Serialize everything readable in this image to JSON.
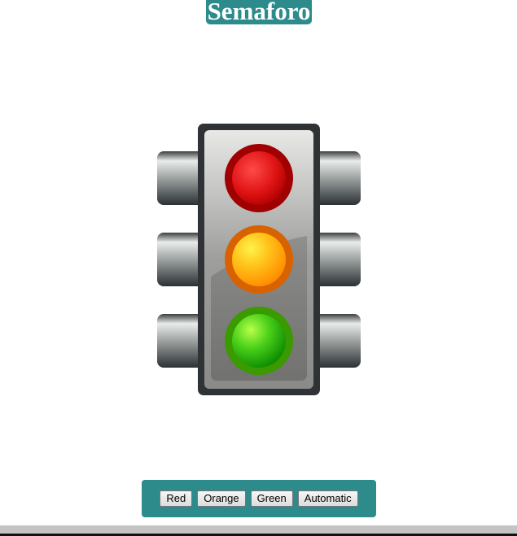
{
  "header": {
    "title": "Semaforo"
  },
  "traffic_light": {
    "lamps": [
      "red",
      "orange",
      "green"
    ],
    "colors": {
      "red": "#e01010",
      "orange": "#ffb000",
      "green": "#22b000",
      "housing": "#2f3336"
    }
  },
  "controls": {
    "background": "#2e8b8b",
    "red_label": "Red",
    "orange_label": "Orange",
    "green_label": "Green",
    "automatic_label": "Automatic"
  }
}
